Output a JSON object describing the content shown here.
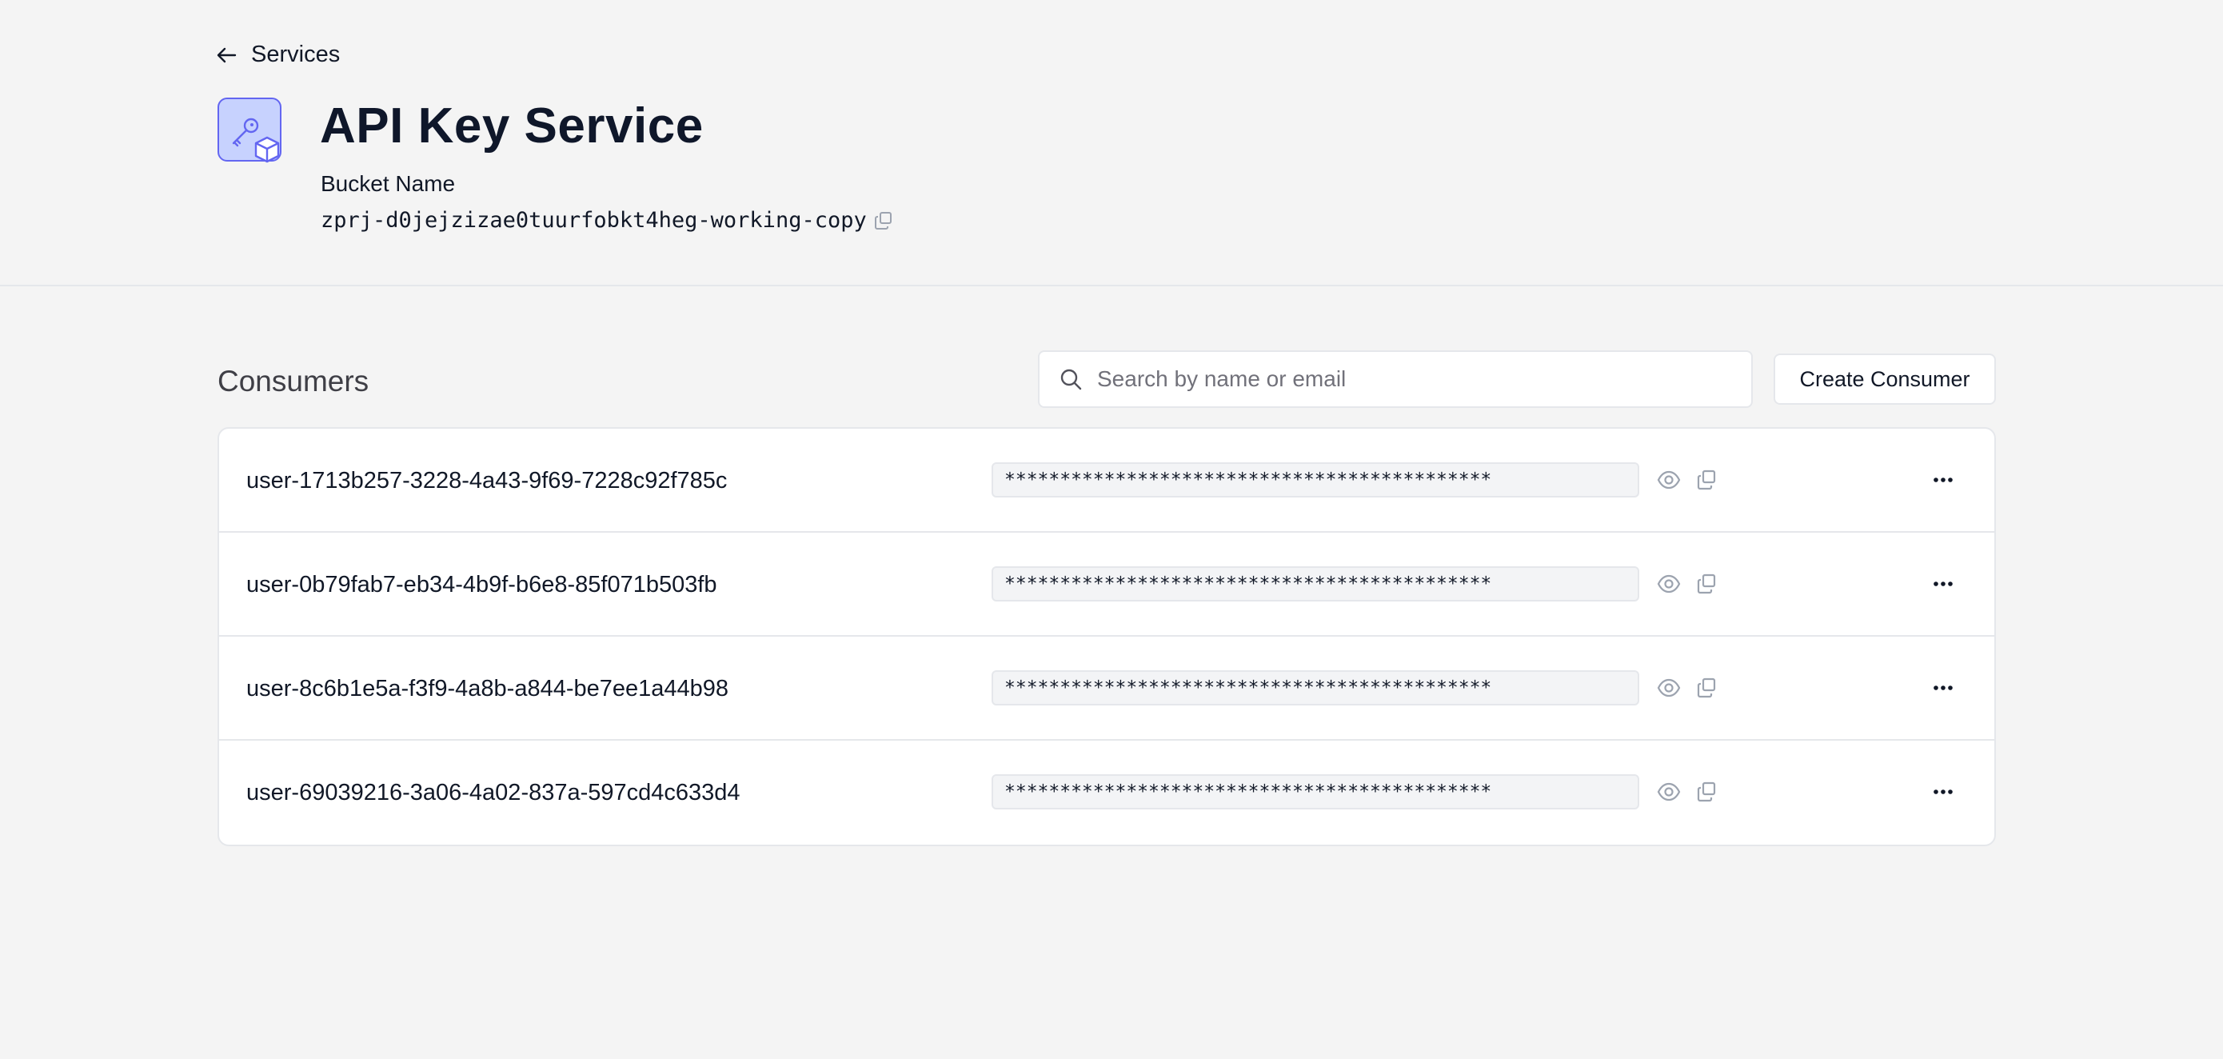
{
  "breadcrumb": {
    "back_label": "Services"
  },
  "service": {
    "title": "API Key Service",
    "icon": "key-package-icon",
    "bucket_label": "Bucket Name",
    "bucket_value": "zprj-d0jejzizae0tuurfobkt4heg-working-copy"
  },
  "consumers": {
    "section_title": "Consumers",
    "search_placeholder": "Search by name or email",
    "search_value": "",
    "create_button_label": "Create Consumer",
    "rows": [
      {
        "name": "user-1713b257-3228-4a43-9f69-7228c92f785c",
        "key_masked": "********************************************"
      },
      {
        "name": "user-0b79fab7-eb34-4b9f-b6e8-85f071b503fb",
        "key_masked": "********************************************"
      },
      {
        "name": "user-8c6b1e5a-f3f9-4a8b-a844-be7ee1a44b98",
        "key_masked": "********************************************"
      },
      {
        "name": "user-69039216-3a06-4a02-837a-597cd4c633d4",
        "key_masked": "********************************************"
      }
    ]
  },
  "colors": {
    "background": "#f4f4f4",
    "accent": "#6366f1",
    "accent_light": "#c7d2fe",
    "border": "#e5e7eb",
    "text": "#111827",
    "muted_icon": "#9ca3af"
  }
}
